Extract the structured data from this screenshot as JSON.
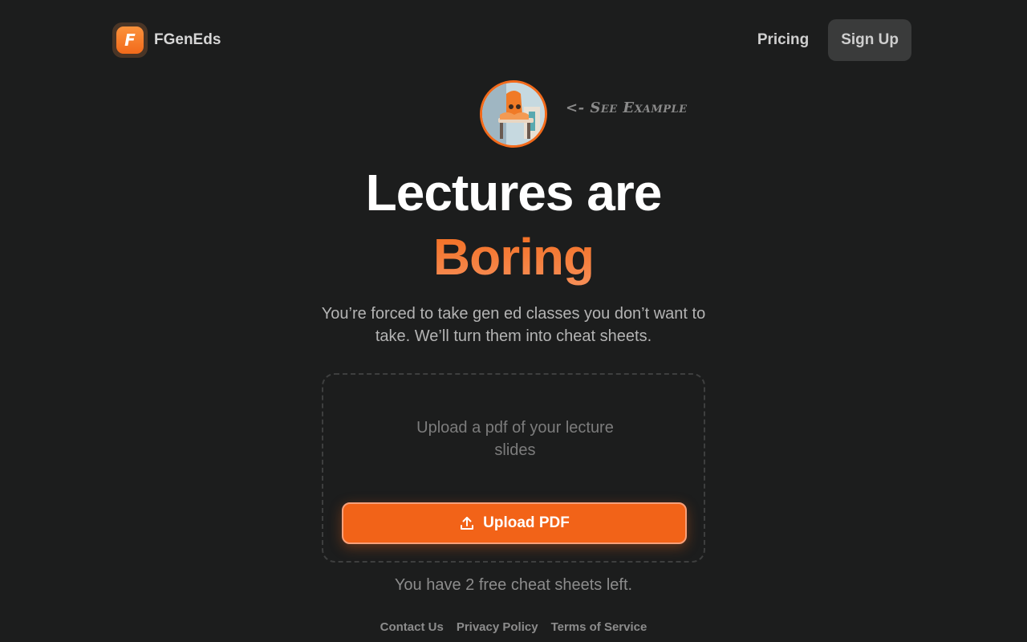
{
  "header": {
    "brand_name": "FGenEds",
    "logo_letter": "F",
    "nav": {
      "pricing": "Pricing",
      "signup": "Sign Up"
    }
  },
  "hero": {
    "see_example": "<- See Example",
    "headline_line1": "Lectures are",
    "headline_line2": "Boring",
    "subtitle": "You’re forced to take gen ed classes you don’t want to take. We’ll turn them into cheat sheets."
  },
  "upload": {
    "prompt": "Upload a pdf of your lecture slides",
    "button_label": "Upload PDF",
    "icon": "upload-icon"
  },
  "free_left": "You have 2 free cheat sheets left.",
  "footer": {
    "links": [
      "Contact Us",
      "Privacy Policy",
      "Terms of Service"
    ]
  },
  "colors": {
    "background": "#1c1d1d",
    "accent": "#f26318",
    "accent_light": "#f7905a",
    "signup_bg": "#3a3b3b"
  }
}
